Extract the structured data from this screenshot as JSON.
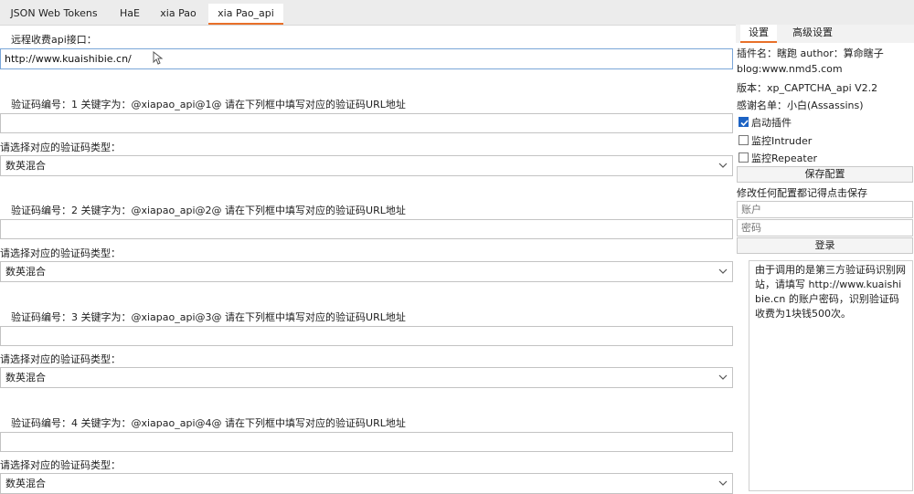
{
  "tabs": [
    {
      "label": "JSON Web Tokens"
    },
    {
      "label": "HaE"
    },
    {
      "label": "xia Pao"
    },
    {
      "label": "xia Pao_api"
    }
  ],
  "main": {
    "api_label": "远程收费api接口：",
    "api_value": "http://www.kuaishibie.cn/",
    "captchas": [
      {
        "title": "验证码编号：1  关键字为：@xiapao_api@1@     请在下列框中填写对应的验证码URL地址",
        "url": "",
        "type_label": "请选择对应的验证码类型：",
        "type_value": "数英混合"
      },
      {
        "title": "验证码编号：2  关键字为：@xiapao_api@2@     请在下列框中填写对应的验证码URL地址",
        "url": "",
        "type_label": "请选择对应的验证码类型：",
        "type_value": "数英混合"
      },
      {
        "title": "验证码编号：3  关键字为：@xiapao_api@3@     请在下列框中填写对应的验证码URL地址",
        "url": "",
        "type_label": "请选择对应的验证码类型：",
        "type_value": "数英混合"
      },
      {
        "title": "验证码编号：4  关键字为：@xiapao_api@4@     请在下列框中填写对应的验证码URL地址",
        "url": "",
        "type_label": "请选择对应的验证码类型：",
        "type_value": "数英混合"
      }
    ]
  },
  "side": {
    "tabs": [
      {
        "label": "设置"
      },
      {
        "label": "高级设置"
      }
    ],
    "plugin": "插件名：瞎跑 author：算命瞎子",
    "blog": "blog:www.nmd5.com",
    "version": "版本：xp_CAPTCHA_api V2.2",
    "thanks": "感谢名单：小白(Assassins)",
    "enable": "启动插件",
    "intruder": "监控Intruder",
    "repeater": "监控Repeater",
    "save": "保存配置",
    "hint": "修改任何配置都记得点击保存",
    "account_placeholder": "账户",
    "password_placeholder": "密码",
    "login": "登录",
    "notice": "由于调用的是第三方验证码识别网站，请填写 http://www.kuaishibie.cn 的账户密码，识别验证码收费为1块钱500次。"
  }
}
